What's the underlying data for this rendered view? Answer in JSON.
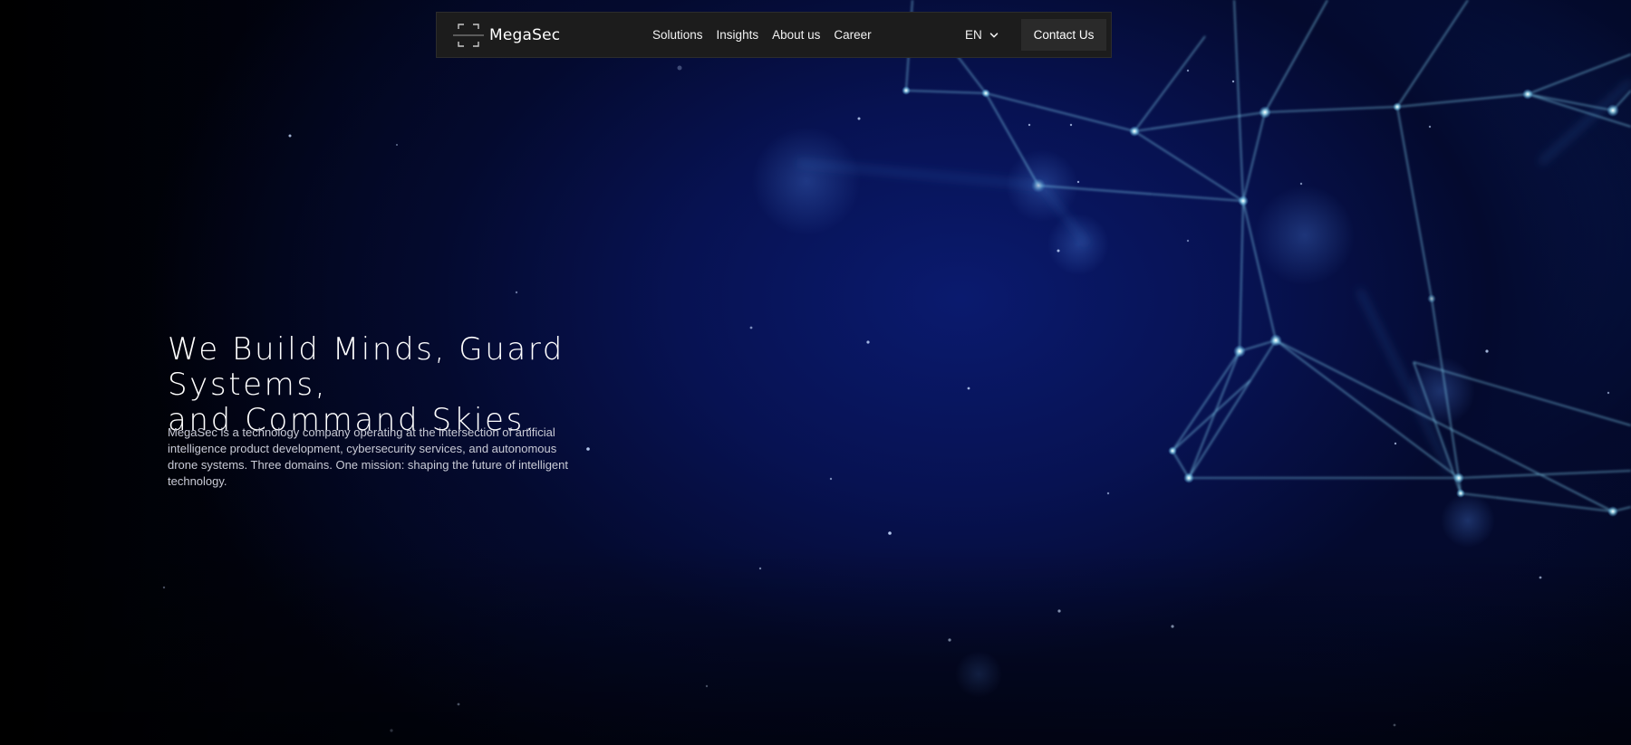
{
  "brand": {
    "name": "MegaSec",
    "logo_icon": "corner-brackets-icon"
  },
  "nav": {
    "links": [
      "Solutions",
      "Insights",
      "About us",
      "Career"
    ],
    "language": "EN",
    "language_icon": "chevron-down-icon",
    "contact_label": "Contact Us"
  },
  "hero": {
    "headline_line1": "We Build Minds, Guard Systems,",
    "headline_line2": "and Command Skies.",
    "description": "MegaSec is a technology company operating at the intersection of artificial intelligence product development, cybersecurity services, and autonomous drone systems. Three domains. One mission: shaping the future of intelligent technology."
  },
  "colors": {
    "background": "#000000",
    "navbar_bg": "#1c1c1c",
    "button_bg": "#2a2a2a",
    "network_glow": "#8fe0ff",
    "deep_blue": "#071252"
  }
}
